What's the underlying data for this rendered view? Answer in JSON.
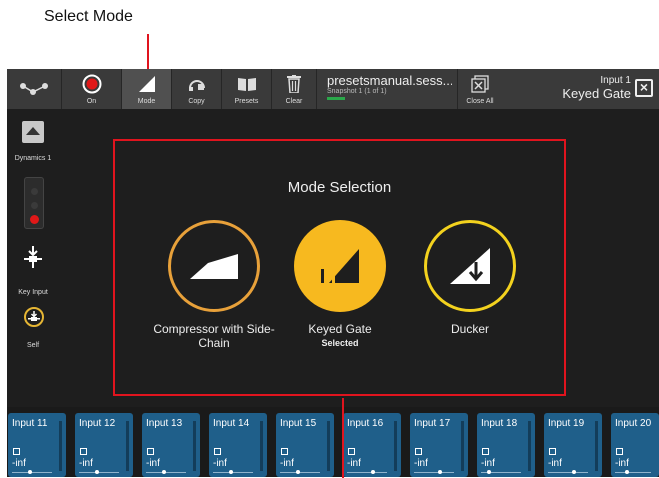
{
  "callout": {
    "label": "Select Mode"
  },
  "toolbar": {
    "on_label": "On",
    "mode_label": "Mode",
    "copy_label": "Copy",
    "presets_label": "Presets",
    "clear_label": "Clear",
    "session_name": "presetsmanual.sess...",
    "snapshot": "Snapshot 1 (1 of 1)",
    "close_all_label": "Close All",
    "channel_name": "Input 1",
    "channel_mode": "Keyed Gate"
  },
  "sidebar": {
    "dynamics_label": "Dynamics 1",
    "key_input_label": "Key Input",
    "self_label": "Self"
  },
  "modal": {
    "title": "Mode Selection",
    "options": [
      {
        "name": "Compressor with Side-Chain",
        "status": ""
      },
      {
        "name": "Keyed Gate",
        "status": "Selected"
      },
      {
        "name": "Ducker",
        "status": ""
      }
    ]
  },
  "strip": [
    {
      "name": "Input 11",
      "value": "-inf"
    },
    {
      "name": "Input 12",
      "value": "-inf"
    },
    {
      "name": "Input 13",
      "value": "-inf"
    },
    {
      "name": "Input 14",
      "value": "-inf"
    },
    {
      "name": "Input 15",
      "value": "-inf"
    },
    {
      "name": "Input 16",
      "value": "-inf"
    },
    {
      "name": "Input 17",
      "value": "-inf"
    },
    {
      "name": "Input 18",
      "value": "-inf"
    },
    {
      "name": "Input 19",
      "value": "-inf"
    },
    {
      "name": "Input 20",
      "value": "-inf"
    }
  ],
  "colors": {
    "accent_red": "#e0141e",
    "selected": "#f7b91f",
    "tile": "#1f5f8a",
    "compressor_ring": "#e8a13a",
    "ducker_ring": "#f3d21e"
  }
}
